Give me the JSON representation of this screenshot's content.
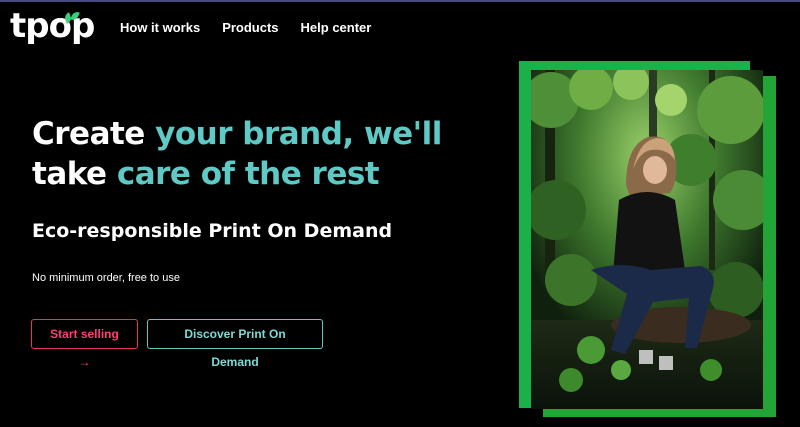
{
  "brand": {
    "logo_text": "tpop"
  },
  "nav": {
    "items": [
      {
        "label": "How it works"
      },
      {
        "label": "Products"
      },
      {
        "label": "Help center"
      }
    ]
  },
  "hero": {
    "headline": {
      "part1": "Create ",
      "part2": "your brand, we'll",
      "part3": "take ",
      "part4": "care of the rest"
    },
    "subtitle": "Eco-responsible Print On Demand",
    "note": "No minimum order, free to use",
    "primary_button": "Start selling →",
    "secondary_button": "Discover Print On Demand",
    "image_icon": "photo-woman-in-forest"
  },
  "colors": {
    "background": "#000000",
    "accent_teal": "#5fc9c6",
    "accent_pink": "#e8326a",
    "frame_green": "#22a436"
  }
}
